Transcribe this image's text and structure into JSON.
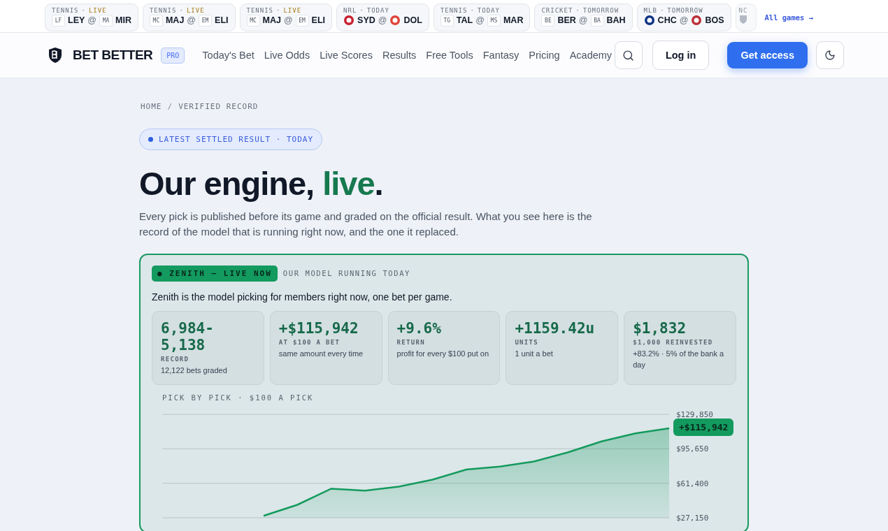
{
  "ticker": {
    "dot": "·",
    "at": "@",
    "games": [
      {
        "league": "TENNIS",
        "status": "LIVE",
        "live": true,
        "home": {
          "code": "LEY",
          "badge": "LF",
          "kind": "abbr"
        },
        "away": {
          "code": "MIR",
          "badge": "MA",
          "kind": "abbr"
        }
      },
      {
        "league": "TENNIS",
        "status": "LIVE",
        "live": true,
        "home": {
          "code": "MAJ",
          "badge": "MC",
          "kind": "abbr"
        },
        "away": {
          "code": "ELI",
          "badge": "EM",
          "kind": "abbr"
        }
      },
      {
        "league": "TENNIS",
        "status": "LIVE",
        "live": true,
        "home": {
          "code": "MAJ",
          "badge": "MC",
          "kind": "abbr"
        },
        "away": {
          "code": "ELI",
          "badge": "EM",
          "kind": "abbr"
        }
      },
      {
        "league": "NRL",
        "status": "TODAY",
        "live": false,
        "home": {
          "code": "SYD",
          "kind": "logo",
          "color": "#c8202f"
        },
        "away": {
          "code": "DOL",
          "kind": "logo",
          "color": "#e0453a"
        }
      },
      {
        "league": "TENNIS",
        "status": "TODAY",
        "live": false,
        "home": {
          "code": "TAL",
          "badge": "TG",
          "kind": "abbr"
        },
        "away": {
          "code": "MAR",
          "badge": "MS",
          "kind": "abbr"
        }
      },
      {
        "league": "CRICKET",
        "status": "TOMORROW",
        "live": false,
        "home": {
          "code": "BER",
          "badge": "BE",
          "kind": "abbr"
        },
        "away": {
          "code": "BAH",
          "badge": "BA",
          "kind": "abbr"
        }
      },
      {
        "league": "MLB",
        "status": "TOMORROW",
        "live": false,
        "home": {
          "code": "CHC",
          "kind": "logo",
          "color": "#0e3386"
        },
        "away": {
          "code": "BOS",
          "kind": "logo",
          "color": "#bd3039"
        }
      }
    ],
    "partial": {
      "league": "NC"
    },
    "all_link": "All games →"
  },
  "nav": {
    "brand": "BET BETTER",
    "badge": "PRO",
    "links": [
      "Today's Bet",
      "Live Odds",
      "Live Scores",
      "Results",
      "Free Tools",
      "Fantasy",
      "Pricing",
      "Academy"
    ],
    "login": "Log in",
    "cta": "Get access"
  },
  "breadcrumb": [
    "HOME",
    "VERIFIED RECORD"
  ],
  "breadcrumb_separator": "/",
  "pill": "LATEST SETTLED RESULT · TODAY",
  "headline": {
    "start": "Our engine, ",
    "accent": "live",
    "end": "."
  },
  "intro": "Every pick is published before its game and graded on the official result. What you see here is the record of the model that is running right now, and the one it replaced.",
  "model": {
    "tag": "● ZENITH — LIVE NOW",
    "subtitle": "OUR MODEL RUNNING TODAY",
    "description": "Zenith is the model picking for members right now, one bet per game.",
    "stats": [
      {
        "value": "6,984-5,138",
        "label": "RECORD",
        "note": "12,122 bets graded"
      },
      {
        "value": "+$115,942",
        "label": "AT $100 A BET",
        "note": "same amount every time"
      },
      {
        "value": "+9.6%",
        "label": "RETURN",
        "note": "profit for every $100 put on"
      },
      {
        "value": "+1159.42u",
        "label": "UNITS",
        "note": "1 unit a bet"
      },
      {
        "value": "$1,832",
        "label": "$1,000 REINVESTED",
        "note": "+83.2% · 5% of the bank a day"
      }
    ],
    "chart_badge": "+$115,942",
    "chart_data": {
      "type": "area",
      "title": "PICK BY PICK · $100 A PICK",
      "series": [
        {
          "color": "#149a5e",
          "values": [
            null,
            null,
            null,
            29000,
            40000,
            56000,
            54000,
            58000,
            65000,
            75000,
            78000,
            83000,
            92000,
            103000,
            111000,
            116000
          ]
        }
      ],
      "ylim": [
        27150,
        129850
      ],
      "yticks": [
        {
          "value": 129850,
          "label": "$129,850"
        },
        {
          "value": 95650,
          "label": "$95,650"
        },
        {
          "value": 61400,
          "label": "$61,400"
        },
        {
          "value": 27150,
          "label": "$27,150"
        }
      ]
    }
  }
}
